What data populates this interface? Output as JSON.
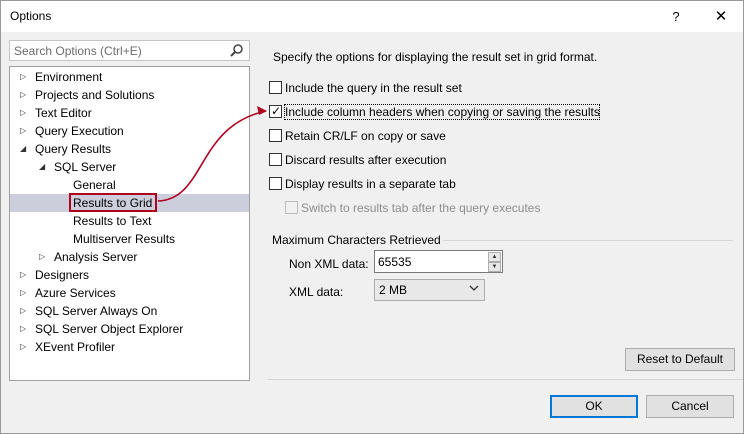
{
  "window": {
    "title": "Options",
    "help_glyph": "?",
    "close_glyph": "✕"
  },
  "search": {
    "placeholder": "Search Options (Ctrl+E)"
  },
  "tree": [
    {
      "label": "Environment",
      "expanded": false,
      "level": 0
    },
    {
      "label": "Projects and Solutions",
      "expanded": false,
      "level": 0
    },
    {
      "label": "Text Editor",
      "expanded": false,
      "level": 0
    },
    {
      "label": "Query Execution",
      "expanded": false,
      "level": 0
    },
    {
      "label": "Query Results",
      "expanded": true,
      "level": 0
    },
    {
      "label": "SQL Server",
      "expanded": true,
      "level": 1
    },
    {
      "label": "General",
      "level": 2
    },
    {
      "label": "Results to Grid",
      "level": 2,
      "selected": true
    },
    {
      "label": "Results to Text",
      "level": 2
    },
    {
      "label": "Multiserver Results",
      "level": 2
    },
    {
      "label": "Analysis Server",
      "expanded": false,
      "level": 1
    },
    {
      "label": "Designers",
      "expanded": false,
      "level": 0
    },
    {
      "label": "Azure Services",
      "expanded": false,
      "level": 0
    },
    {
      "label": "SQL Server Always On",
      "expanded": false,
      "level": 0
    },
    {
      "label": "SQL Server Object Explorer",
      "expanded": false,
      "level": 0
    },
    {
      "label": "XEvent Profiler",
      "expanded": false,
      "level": 0
    }
  ],
  "main": {
    "description": "Specify the options for displaying the result set in grid format.",
    "options": [
      {
        "label": "Include the query in the result set",
        "checked": false,
        "enabled": true
      },
      {
        "label": "Include column headers when copying or saving the results",
        "checked": true,
        "enabled": true
      },
      {
        "label": "Retain CR/LF on copy or save",
        "checked": false,
        "enabled": true
      },
      {
        "label": "Discard results after execution",
        "checked": false,
        "enabled": true
      },
      {
        "label": "Display results in a separate tab",
        "checked": false,
        "enabled": true
      },
      {
        "label": "Switch to results tab after the query executes",
        "checked": false,
        "enabled": false
      }
    ],
    "group_title": "Maximum Characters Retrieved",
    "non_xml_label": "Non XML data:",
    "non_xml_value": "65535",
    "xml_label": "XML data:",
    "xml_value": "2 MB"
  },
  "buttons": {
    "reset": "Reset to Default",
    "ok": "OK",
    "cancel": "Cancel"
  },
  "colors": {
    "selection": "#cccedb",
    "annotation": "#b00020",
    "ok_border": "#0078d7"
  }
}
